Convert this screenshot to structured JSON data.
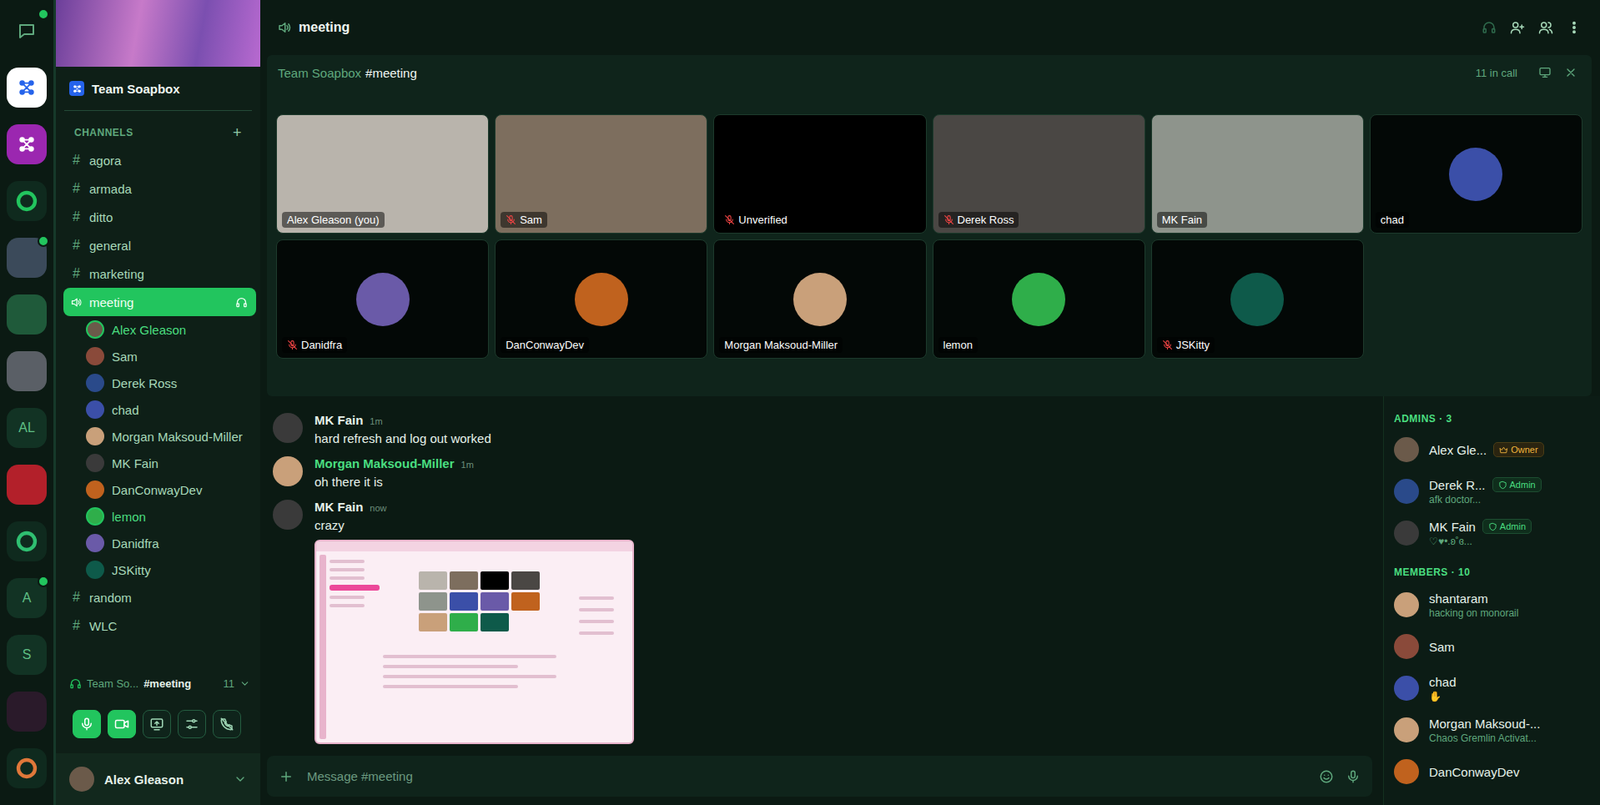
{
  "header": {
    "title": "meeting"
  },
  "rail": [
    {
      "kind": "dm",
      "label": "",
      "selected": false,
      "unread": true,
      "color": "#5fa87d"
    },
    {
      "kind": "nodes",
      "label": "",
      "selected": true,
      "unread": false,
      "color": "#ffffff"
    },
    {
      "kind": "nodes",
      "label": "",
      "selected": false,
      "unread": false,
      "color": "#9b27b0"
    },
    {
      "kind": "ring",
      "label": "",
      "selected": false,
      "unread": false,
      "color": "#22c55e"
    },
    {
      "kind": "image",
      "label": "",
      "selected": false,
      "unread": true,
      "color": "#3b4a5a"
    },
    {
      "kind": "image",
      "label": "",
      "selected": false,
      "unread": false,
      "color": "#1f5a3a"
    },
    {
      "kind": "image",
      "label": "",
      "selected": false,
      "unread": false,
      "color": "#5a5f66"
    },
    {
      "kind": "text",
      "label": "AL",
      "selected": false,
      "unread": false,
      "color": "#123324"
    },
    {
      "kind": "image",
      "label": "",
      "selected": false,
      "unread": false,
      "color": "#b3202a"
    },
    {
      "kind": "ring",
      "label": "",
      "selected": false,
      "unread": false,
      "color": "#2fbf71"
    },
    {
      "kind": "text",
      "label": "A",
      "selected": false,
      "unread": true,
      "color": "#123324"
    },
    {
      "kind": "text",
      "label": "S",
      "selected": false,
      "unread": false,
      "color": "#123324"
    },
    {
      "kind": "image",
      "label": "",
      "selected": false,
      "unread": false,
      "color": "#2a1a2a"
    },
    {
      "kind": "ring",
      "label": "",
      "selected": false,
      "unread": false,
      "color": "#e0783a"
    }
  ],
  "team": {
    "name": "Team Soapbox"
  },
  "channels_heading": "CHANNELS",
  "add_channel": "+",
  "channel_prefix": "#",
  "channels": [
    {
      "name": "agora",
      "kind": "text",
      "selected": false
    },
    {
      "name": "armada",
      "kind": "text",
      "selected": false
    },
    {
      "name": "ditto",
      "kind": "text",
      "selected": false
    },
    {
      "name": "general",
      "kind": "text",
      "selected": false
    },
    {
      "name": "marketing",
      "kind": "text",
      "selected": false
    },
    {
      "name": "meeting",
      "kind": "voice",
      "selected": true
    },
    {
      "name": "random",
      "kind": "text",
      "selected": false
    },
    {
      "name": "WLC",
      "kind": "text",
      "selected": false
    }
  ],
  "voice_participants": [
    {
      "name": "Alex Gleason",
      "speaking": true,
      "color": "#6b5a4a"
    },
    {
      "name": "Sam",
      "speaking": false,
      "color": "#8a4a3a"
    },
    {
      "name": "Derek Ross",
      "speaking": false,
      "color": "#2a4a8a"
    },
    {
      "name": "chad",
      "speaking": false,
      "color": "#3b4fa8"
    },
    {
      "name": "Morgan Maksoud-Miller",
      "speaking": false,
      "color": "#c9a07a"
    },
    {
      "name": "MK Fain",
      "speaking": false,
      "color": "#3a3a3a"
    },
    {
      "name": "DanConwayDev",
      "speaking": false,
      "color": "#c0621e"
    },
    {
      "name": "lemon",
      "speaking": true,
      "color": "#2fae4a"
    },
    {
      "name": "Danidfra",
      "speaking": false,
      "color": "#6a5aa8"
    },
    {
      "name": "JSKitty",
      "speaking": false,
      "color": "#0e5a4a"
    }
  ],
  "voice_panel": {
    "server": "Team So...",
    "channel": "#meeting",
    "count": "11",
    "controls": [
      {
        "kind": "mic",
        "on": true
      },
      {
        "kind": "camera",
        "on": true
      },
      {
        "kind": "screen",
        "on": false
      },
      {
        "kind": "sliders",
        "on": false
      },
      {
        "kind": "phone-off",
        "on": false
      }
    ]
  },
  "user": {
    "name": "Alex Gleason",
    "color": "#6b5a4a"
  },
  "call": {
    "team": "Team Soapbox",
    "channel": "#meeting",
    "count": "11 in call",
    "tiles": [
      {
        "name": "Alex Gleason (you)",
        "kind": "video",
        "muted": false,
        "color": "#b9b4ac"
      },
      {
        "name": "Sam",
        "kind": "video",
        "muted": true,
        "color": "#7d6e5e"
      },
      {
        "name": "Unverified",
        "kind": "empty",
        "muted": true,
        "color": "#000000"
      },
      {
        "name": "Derek Ross",
        "kind": "video",
        "muted": true,
        "color": "#4a4744"
      },
      {
        "name": "MK Fain",
        "kind": "video",
        "muted": false,
        "color": "#8e948c"
      },
      {
        "name": "chad",
        "kind": "avatar",
        "muted": false,
        "color": "#3b4fa8"
      },
      {
        "name": "Danidfra",
        "kind": "avatar",
        "muted": true,
        "color": "#6a5aa8"
      },
      {
        "name": "DanConwayDev",
        "kind": "avatar",
        "muted": false,
        "color": "#c0621e"
      },
      {
        "name": "Morgan Maksoud-Miller",
        "kind": "avatar",
        "muted": false,
        "color": "#c9a07a"
      },
      {
        "name": "lemon",
        "kind": "avatar",
        "muted": false,
        "color": "#2fae4a"
      },
      {
        "name": "JSKitty",
        "kind": "avatar",
        "muted": true,
        "color": "#0e5a4a"
      }
    ]
  },
  "messages": [
    {
      "author": "MK Fain",
      "time": "1m",
      "text": "hard refresh and log out worked",
      "color": "#e6f2ea",
      "avatar_color": "#3a3a3a",
      "has_screenshot": false
    },
    {
      "author": "Morgan Maksoud-Miller",
      "time": "1m",
      "text": "oh there it is",
      "color": "#4ade80",
      "avatar_color": "#c9a07a",
      "has_screenshot": false
    },
    {
      "author": "MK Fain",
      "time": "now",
      "text": "crazy",
      "color": "#e6f2ea",
      "avatar_color": "#3a3a3a",
      "has_screenshot": true
    }
  ],
  "composer": {
    "placeholder": "Message #meeting"
  },
  "member_sections": [
    {
      "heading": "ADMINS · 3",
      "members": [
        {
          "name": "Alex Gle...",
          "status": "",
          "kind": "owner",
          "badge": "Owner",
          "color": "#6b5a4a"
        },
        {
          "name": "Derek R...",
          "status": "afk doctor...",
          "kind": "admin",
          "badge": "Admin",
          "color": "#2a4a8a"
        },
        {
          "name": "MK Fain",
          "status": "♡♥•.ʚ˚ɞ...",
          "kind": "admin",
          "badge": "Admin",
          "color": "#3a3a3a"
        }
      ]
    },
    {
      "heading": "MEMBERS · 10",
      "members": [
        {
          "name": "shantaram",
          "status": "hacking on monorail",
          "kind": "member",
          "badge": "",
          "color": "#c9a07a"
        },
        {
          "name": "Sam",
          "status": "",
          "kind": "member",
          "badge": "",
          "color": "#8a4a3a"
        },
        {
          "name": "chad",
          "status": "✋",
          "kind": "member",
          "badge": "",
          "color": "#3b4fa8"
        },
        {
          "name": "Morgan Maksoud-...",
          "status": "Chaos Gremlin Activat...",
          "kind": "member",
          "badge": "",
          "color": "#c9a07a"
        },
        {
          "name": "DanConwayDev",
          "status": "",
          "kind": "member",
          "badge": "",
          "color": "#c0621e"
        }
      ]
    }
  ]
}
